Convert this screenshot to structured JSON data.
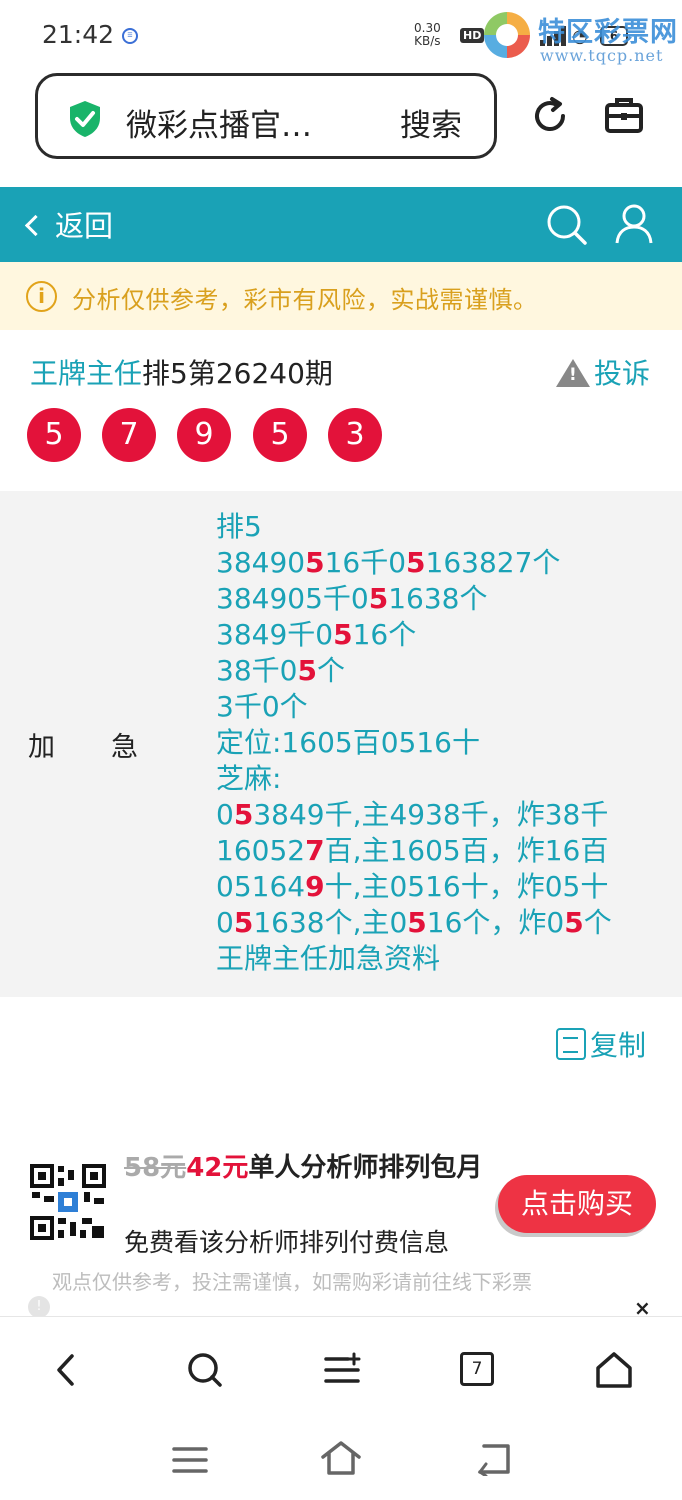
{
  "status": {
    "time": "21:42",
    "net_speed_value": "0.30",
    "net_speed_unit": "KB/s",
    "hd": "HD",
    "battery": "6"
  },
  "watermark": {
    "title": "特区彩票网",
    "url": "www.tqcp.net"
  },
  "browser": {
    "url_title": "微彩点播官…",
    "search_label": "搜索"
  },
  "header": {
    "back_label": "返回"
  },
  "notice": {
    "text": "分析仅供参考，彩市有风险，实战需谨慎。",
    "icon": "info-icon"
  },
  "post": {
    "author": "王牌主任",
    "title_rest": "排5第26240期",
    "complain_label": "投诉",
    "balls": [
      "5",
      "7",
      "9",
      "5",
      "3"
    ]
  },
  "panel": {
    "label": "加急",
    "lines": [
      [
        {
          "t": "排5"
        }
      ],
      [
        {
          "t": "38490"
        },
        {
          "t": "5",
          "red": true
        },
        {
          "t": "16千0"
        },
        {
          "t": "5",
          "red": true
        },
        {
          "t": "163827个"
        }
      ],
      [
        {
          "t": "384905"
        },
        {
          "t": "",
          "red": true
        },
        {
          "t": "千0"
        },
        {
          "t": "5",
          "red": true
        },
        {
          "t": "1638个"
        }
      ],
      [
        {
          "t": "3849千0"
        },
        {
          "t": "5",
          "red": true
        },
        {
          "t": "16个"
        }
      ],
      [
        {
          "t": "38千0"
        },
        {
          "t": "5",
          "red": true
        },
        {
          "t": "个"
        }
      ],
      [
        {
          "t": "3千0个"
        }
      ],
      [
        {
          "t": "定位:1605百0516十"
        }
      ],
      [
        {
          "t": "芝麻:"
        }
      ],
      [
        {
          "t": "0"
        },
        {
          "t": "5",
          "red": true
        },
        {
          "t": "3849千,主4938千，炸38千"
        }
      ],
      [
        {
          "t": "16052"
        },
        {
          "t": "7",
          "red": true
        },
        {
          "t": "百,主1605百，炸16百"
        }
      ],
      [
        {
          "t": "05164"
        },
        {
          "t": "9",
          "red": true
        },
        {
          "t": "十,主0516十，炸05十"
        }
      ],
      [
        {
          "t": "0"
        },
        {
          "t": "5",
          "red": true
        },
        {
          "t": "1638个,主0"
        },
        {
          "t": "5",
          "red": true
        },
        {
          "t": "16个，炸0"
        },
        {
          "t": "5",
          "red": true
        },
        {
          "t": "个"
        }
      ],
      [
        {
          "t": "王牌主任加急资料"
        }
      ]
    ]
  },
  "copy_label": "复制",
  "promo": {
    "old_price": "58元",
    "new_price": "42元",
    "title": "单人分析师排列包月",
    "subtitle": "免费看该分析师排列付费信息",
    "buy_label": "点击购买",
    "disclaimer": "观点仅供参考，投注需谨慎，如需购彩请前往线下彩票",
    "close": "×"
  },
  "toolbar": {
    "tab_count": "7"
  },
  "colors": {
    "teal": "#1aa2b6",
    "red": "#e3123a",
    "notice_bg": "#fff7df",
    "notice_text": "#d9a01e"
  }
}
